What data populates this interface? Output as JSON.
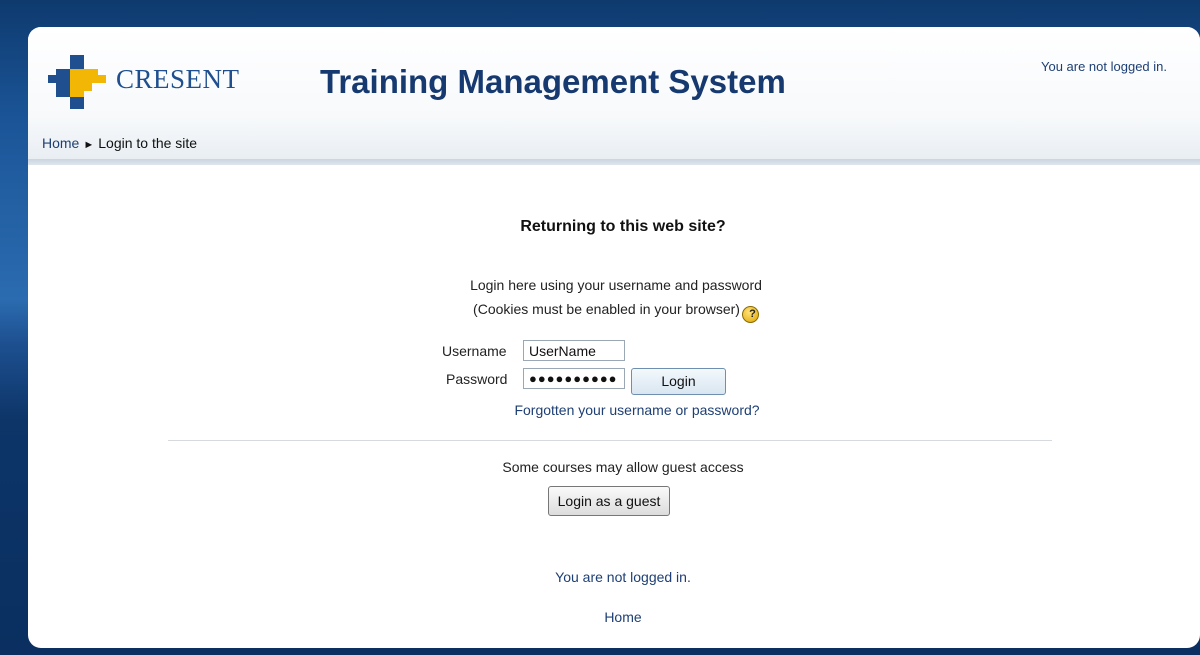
{
  "header": {
    "logo_text": "CRESENT",
    "site_title": "Training Management System",
    "login_status": "You are not logged in."
  },
  "breadcrumb": {
    "home": "Home",
    "separator": "►",
    "current": "Login to the site"
  },
  "login": {
    "heading": "Returning to this web site?",
    "description_line1": "Login here using your username and password",
    "description_line2": "(Cookies must be enabled in your browser)",
    "help_icon_glyph": "?",
    "username_label": "Username",
    "username_value": "UserName",
    "password_label": "Password",
    "password_value": "●●●●●●●●●●",
    "login_button": "Login",
    "forgot_link": "Forgotten your username or password?"
  },
  "guest": {
    "text": "Some courses may allow guest access",
    "button": "Login as a guest"
  },
  "footer": {
    "login_status": "You are not logged in.",
    "home_link": "Home"
  },
  "colors": {
    "link": "#1e3f74",
    "title": "#16396f",
    "logo_blue": "#1f4f8f",
    "logo_yellow": "#f2b705"
  }
}
